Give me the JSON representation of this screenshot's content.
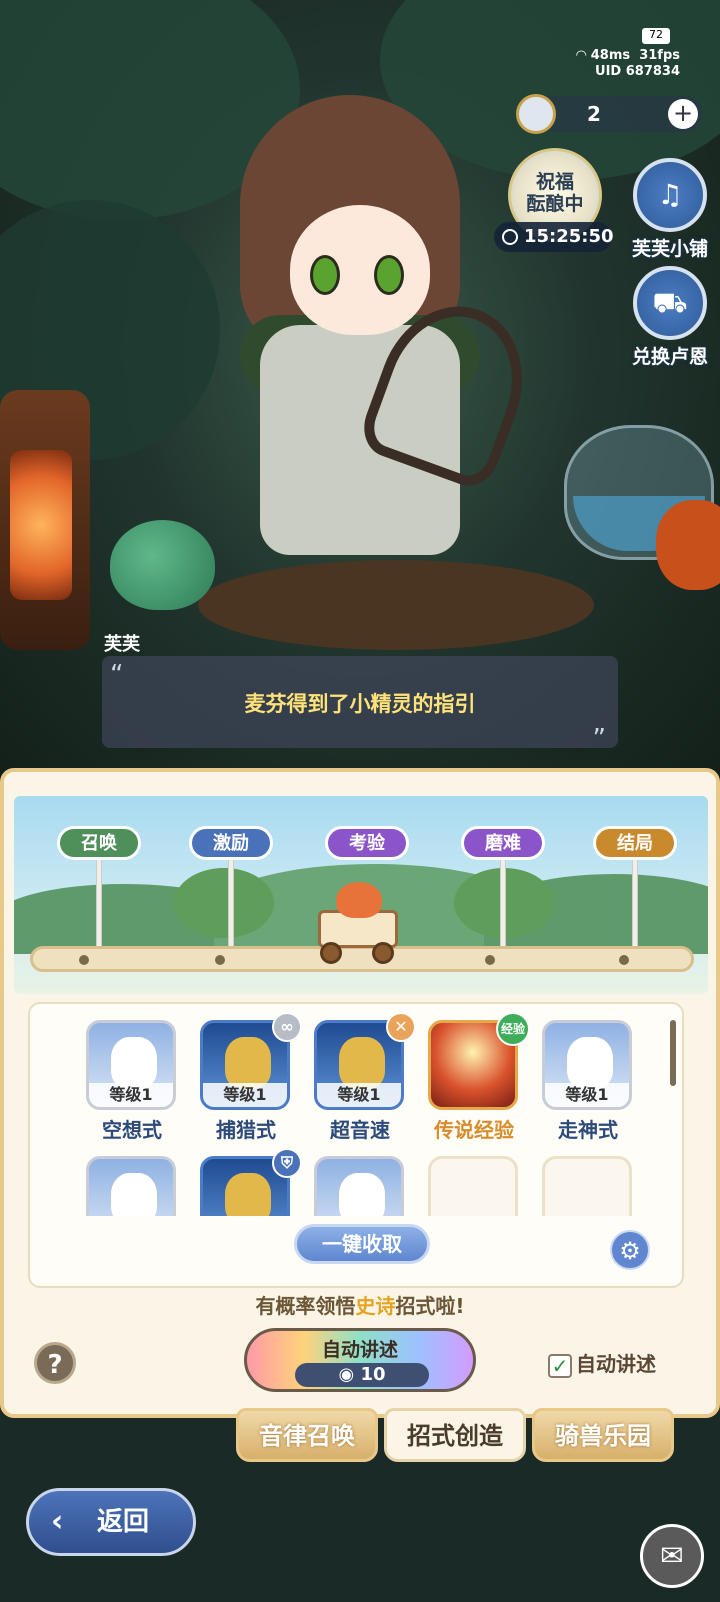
{
  "hud": {
    "battery": "72",
    "ping": "48ms",
    "fps": "31fps",
    "uid": "UID 687834",
    "currency_amount": "2",
    "plus_label": "+"
  },
  "blessing": {
    "line1": "祝福",
    "line2": "酝酿中",
    "timer": "15:25:50"
  },
  "side_buttons": [
    {
      "label": "芙芙小铺",
      "icon": "lyre-icon"
    },
    {
      "label": "兑换卢恩",
      "icon": "shop-cart-icon"
    }
  ],
  "dialogue": {
    "speaker": "芙芙",
    "text": "麦芬得到了小精灵的指引",
    "open_quote": "“",
    "close_quote": "”"
  },
  "stages": [
    {
      "label": "召唤",
      "color": "#4f8f5a"
    },
    {
      "label": "激励",
      "color": "#4a72b8"
    },
    {
      "label": "考验",
      "color": "#8b55c9"
    },
    {
      "label": "磨难",
      "color": "#8b55c9"
    },
    {
      "label": "结局",
      "color": "#c98a2e"
    }
  ],
  "skills": [
    {
      "name": "空想式",
      "level": "等级1",
      "style": "plain",
      "badge": ""
    },
    {
      "name": "捕猎式",
      "level": "等级1",
      "style": "blue",
      "badge": "∞"
    },
    {
      "name": "超音速",
      "level": "等级1",
      "style": "blue",
      "badge": "✕"
    },
    {
      "name": "传说经验",
      "level": "",
      "style": "gold",
      "badge": "经验"
    },
    {
      "name": "走神式",
      "level": "等级1",
      "style": "plain",
      "badge": ""
    }
  ],
  "collect_label": "一键收取",
  "hint": {
    "prefix": "有概率领悟",
    "highlight": "史诗",
    "suffix": "招式啦!"
  },
  "help_label": "?",
  "auto_narrate": {
    "title": "自动讲述",
    "cost": "10"
  },
  "auto_check": {
    "label": "自动讲述",
    "check": "✓"
  },
  "tabs": [
    {
      "label": "音律召唤",
      "active": false
    },
    {
      "label": "招式创造",
      "active": true
    },
    {
      "label": "骑兽乐园",
      "active": false
    }
  ],
  "back_label": "返回",
  "colors": {
    "accent_blue": "#4a72b8",
    "gold": "#e5a31f",
    "panel_bg": "#fbf5e8"
  }
}
